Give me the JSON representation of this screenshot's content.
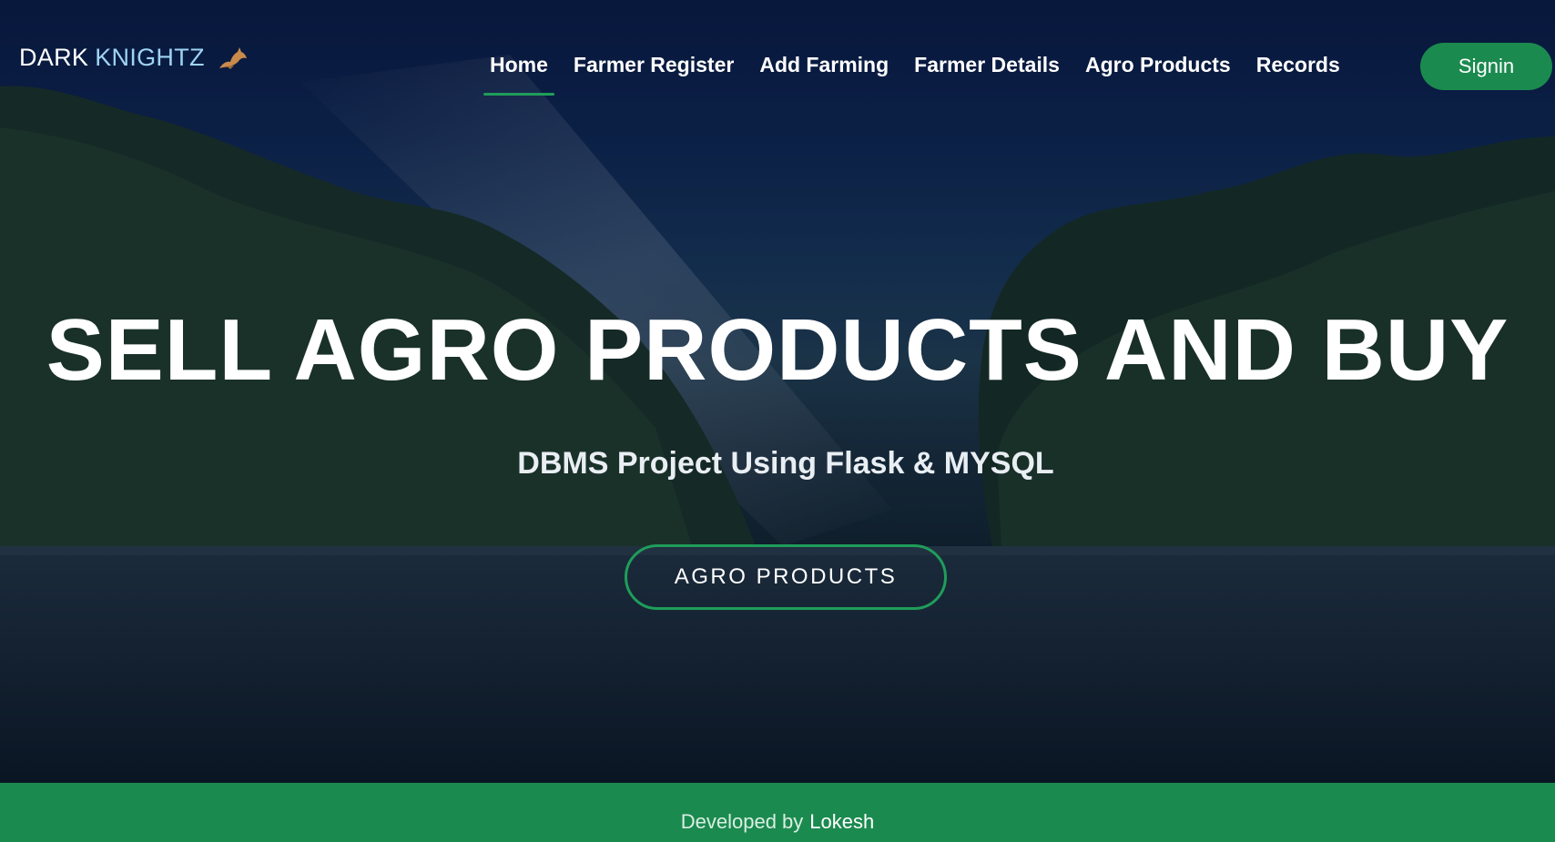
{
  "brand": {
    "first": "DARK",
    "second": "KNIGHTZ",
    "icon": "bat-icon"
  },
  "nav": {
    "items": [
      {
        "label": "Home",
        "active": true
      },
      {
        "label": "Farmer Register",
        "active": false
      },
      {
        "label": "Add Farming",
        "active": false
      },
      {
        "label": "Farmer Details",
        "active": false
      },
      {
        "label": "Agro Products",
        "active": false
      },
      {
        "label": "Records",
        "active": false
      }
    ],
    "signin_label": "Signin"
  },
  "hero": {
    "title": "SELL AGRO PRODUCTS AND BUY",
    "subtitle": "DBMS Project Using Flask & MYSQL",
    "cta_label": "AGRO PRODUCTS"
  },
  "footer": {
    "prefix": "Developed by",
    "name": "Lokesh"
  },
  "colors": {
    "accent": "#1b8a4f",
    "brand_accent": "#9fd3f3",
    "active_underline": "#1f9d5a"
  }
}
